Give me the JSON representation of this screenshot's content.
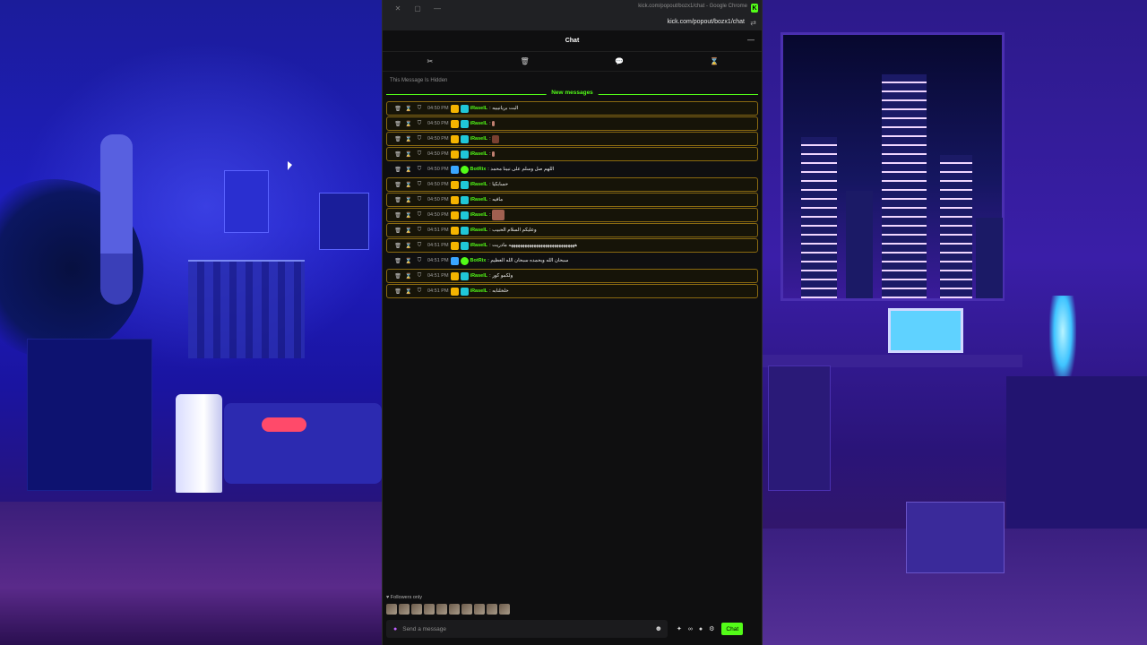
{
  "browser": {
    "window_title": "kick.com/popout/bozx1/chat - Google Chrome",
    "url": "kick.com/popout/bozx1/chat",
    "close_glyph": "✕",
    "restore_glyph": "▢",
    "minimize_glyph": "—",
    "ext_icon": "K"
  },
  "chat": {
    "title": "Chat",
    "collapse_icon": "—",
    "mod_tools": [
      "✂",
      "🗑",
      "💬",
      "⌛"
    ],
    "hidden_notice": "This Message Is Hidden",
    "new_messages_label": "New messages",
    "messages": [
      {
        "time": "04:50 PM",
        "user": "iRaseIL",
        "text": "البت بريانيبيه",
        "user_color": "#53fc18",
        "highlight": true
      },
      {
        "time": "04:50 PM",
        "user": "iRaseIL",
        "text": "",
        "user_color": "#53fc18",
        "highlight": true,
        "emote": "small"
      },
      {
        "time": "04:50 PM",
        "user": "iRaseIL",
        "text": "",
        "user_color": "#53fc18",
        "highlight": true,
        "emote": "normal"
      },
      {
        "time": "04:50 PM",
        "user": "iRaseIL",
        "text": "",
        "user_color": "#53fc18",
        "highlight": true,
        "emote": "small"
      },
      {
        "time": "04:50 PM",
        "user": "BotRix",
        "text": "اللهم صل وسلم على نبينا محمد",
        "user_color": "#53fc18",
        "highlight": false,
        "bot": true
      },
      {
        "time": "04:50 PM",
        "user": "iRaseIL",
        "text": "حسابكيا",
        "user_color": "#53fc18",
        "highlight": true
      },
      {
        "time": "04:50 PM",
        "user": "iRaseIL",
        "text": "مافيه",
        "user_color": "#53fc18",
        "highlight": true
      },
      {
        "time": "04:50 PM",
        "user": "iRaseIL",
        "text": "",
        "user_color": "#53fc18",
        "highlight": true,
        "emote": "big"
      },
      {
        "time": "04:51 PM",
        "user": "iRaseIL",
        "text": "وعليكم السلام الحبيب",
        "user_color": "#53fc18",
        "highlight": true
      },
      {
        "time": "04:51 PM",
        "user": "iRaseIL",
        "text": "هههههههههههههههههههههههههههههه مادريت",
        "user_color": "#53fc18",
        "highlight": true
      },
      {
        "time": "04:51 PM",
        "user": "BotRix",
        "text": "سبحان الله وبحمده سبحان الله العظيم",
        "user_color": "#53fc18",
        "highlight": false,
        "bot": true
      },
      {
        "time": "04:51 PM",
        "user": "iRaseIL",
        "text": "ولكمو كور",
        "user_color": "#53fc18",
        "highlight": true
      },
      {
        "time": "04:51 PM",
        "user": "iRaseIL",
        "text": "خلخلنابه",
        "user_color": "#53fc18",
        "highlight": true
      }
    ],
    "followers_only": "♥ Followers only",
    "input_placeholder": "Send a message",
    "send_label": "Chat",
    "colors": {
      "accent": "#53fc18",
      "background": "#0f0f10",
      "highlight_border": "#8a6a10"
    }
  }
}
